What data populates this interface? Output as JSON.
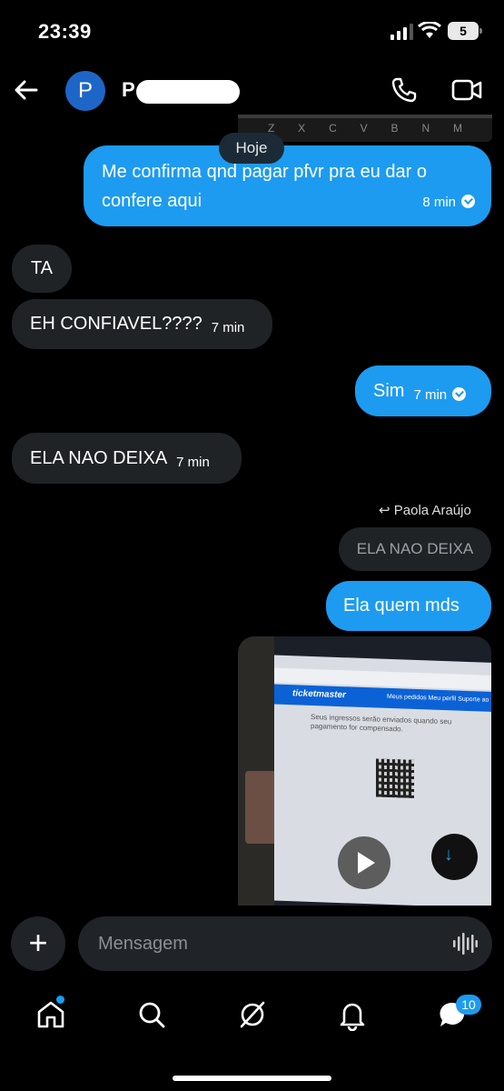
{
  "status_bar": {
    "time": "23:39",
    "battery": "5"
  },
  "header": {
    "avatar_initial": "P",
    "contact_name": "P"
  },
  "keyboard_peek": {
    "keys": [
      "Z",
      "X",
      "C",
      "V",
      "B",
      "N",
      "M"
    ]
  },
  "date_separator": "Hoje",
  "messages": [
    {
      "direction": "out",
      "text": "Me confirma qnd pagar pfvr pra eu dar o confere aqui",
      "time": "8 min",
      "read": true
    },
    {
      "direction": "in",
      "text": "TA",
      "time": ""
    },
    {
      "direction": "in",
      "text": "EH CONFIAVEL????",
      "time": "7 min"
    },
    {
      "direction": "out",
      "text": "Sim",
      "time": "7 min",
      "read": true
    },
    {
      "direction": "in",
      "text": "ELA NAO DEIXA",
      "time": "7 min"
    },
    {
      "direction": "out",
      "text": "Ela quem mds",
      "time": "",
      "reply_to": {
        "author": "Paola Araújo",
        "text": "ELA NAO DEIXA"
      }
    }
  ],
  "reply_label_prefix": "↩",
  "media_preview": {
    "site_logo": "ticketmaster",
    "nav_links": "Meus pedidos   Meu perfil   Suporte ao fã",
    "body_text": "Seus ingressos serão enviados quando seu pagamento for compensado."
  },
  "composer": {
    "placeholder": "Mensagem"
  },
  "tabs": [
    {
      "icon": "home-icon",
      "has_dot": true
    },
    {
      "icon": "search-icon"
    },
    {
      "icon": "grok-icon"
    },
    {
      "icon": "bell-icon"
    },
    {
      "icon": "messages-icon",
      "badge": "10"
    }
  ],
  "colors": {
    "accent": "#1d9bf0",
    "incoming_bubble": "#1f2326",
    "background": "#000000"
  }
}
